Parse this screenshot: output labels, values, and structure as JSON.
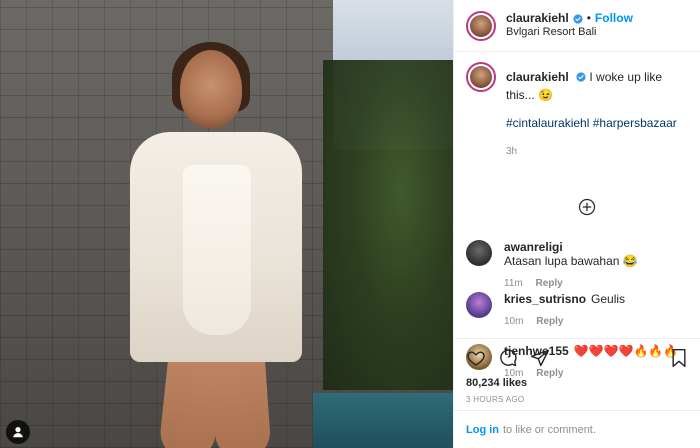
{
  "post": {
    "author": "claurakiehl",
    "follow_label": "Follow",
    "separator": "•",
    "location": "Bvlgari Resort Bali",
    "caption_text": "I woke up like this... 😉",
    "hashtags": "#cintalaurakiehl #harpersbazaar",
    "caption_time": "3h"
  },
  "comments": [
    {
      "user": "awanreligi",
      "text": "Atasan lupa bawahan 😂",
      "time": "11m",
      "reply_label": "Reply"
    },
    {
      "user": "kries_sutrisno",
      "text": "Geulis",
      "time": "10m",
      "reply_label": "Reply"
    },
    {
      "user": "tjenhwe155",
      "text": "❤️❤️❤️❤️🔥🔥🔥",
      "time": "10m",
      "reply_label": "Reply"
    }
  ],
  "actions": {
    "likes": "80,234 likes",
    "posted_ago": "3 HOURS AGO"
  },
  "login": {
    "link": "Log in",
    "text": "to like or comment."
  },
  "colors": {
    "accent": "#0095f6",
    "hashtag": "#00376b",
    "muted": "#8e8e8e"
  }
}
